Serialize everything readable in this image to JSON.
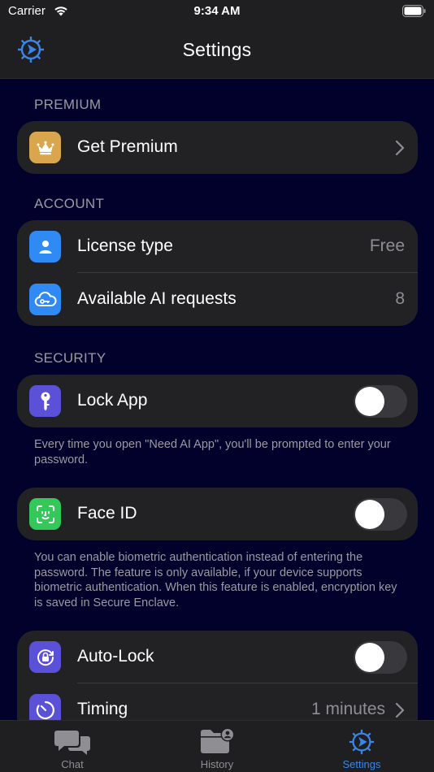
{
  "status_bar": {
    "carrier": "Carrier",
    "time": "9:34 AM"
  },
  "nav": {
    "title": "Settings"
  },
  "sections": {
    "premium": {
      "header": "PREMIUM",
      "get_premium": {
        "label": "Get Premium"
      }
    },
    "account": {
      "header": "ACCOUNT",
      "license": {
        "label": "License type",
        "value": "Free"
      },
      "ai_requests": {
        "label": "Available AI requests",
        "value": "8"
      }
    },
    "security": {
      "header": "SECURITY",
      "lock_app": {
        "label": "Lock App",
        "enabled": false
      },
      "lock_app_footnote": "Every time you open \"Need AI App\", you'll be prompted to enter your password.",
      "face_id": {
        "label": "Face ID",
        "enabled": false
      },
      "face_id_footnote": "You can enable biometric authentication instead of entering the password. The feature is only available, if your device supports biometric authentication. When this feature is enabled, encryption key is saved in Secure Enclave.",
      "auto_lock": {
        "label": "Auto-Lock",
        "enabled": false
      },
      "timing": {
        "label": "Timing",
        "value": "1 minutes"
      }
    }
  },
  "tabs": [
    {
      "label": "Chat",
      "icon": "chat-bubbles-icon",
      "active": false
    },
    {
      "label": "History",
      "icon": "folder-person-icon",
      "active": false
    },
    {
      "label": "Settings",
      "icon": "gear-icon",
      "active": true
    }
  ],
  "colors": {
    "background": "#02012b",
    "card": "#222224",
    "accent": "#3a86e8",
    "premium_icon": "#d9a64e",
    "account_icon": "#2f8af5",
    "lock_icon": "#5b51d8",
    "faceid_icon": "#34c759",
    "autolock_icon": "#5b51d8"
  }
}
